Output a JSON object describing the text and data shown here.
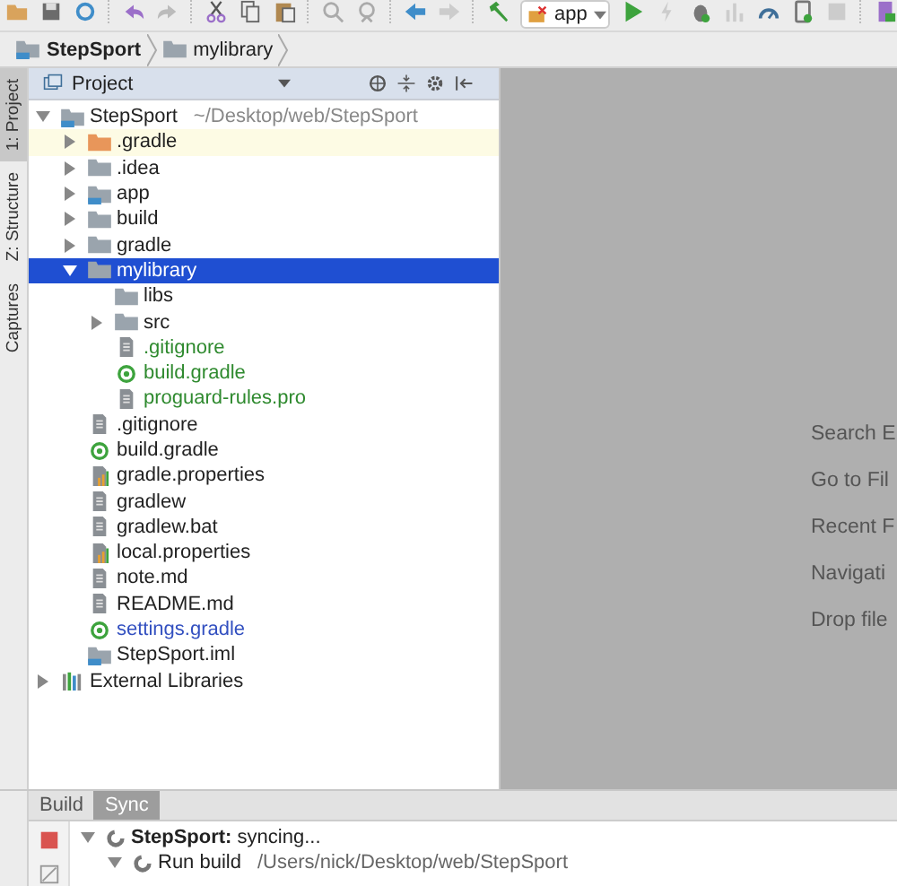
{
  "toolbar": {
    "run_config": "app"
  },
  "breadcrumb": [
    {
      "label": "StepSport",
      "kind": "module"
    },
    {
      "label": "mylibrary",
      "kind": "folder"
    }
  ],
  "side_tabs": [
    {
      "label": "1: Project",
      "selected": true
    },
    {
      "label": "Z: Structure",
      "selected": false
    },
    {
      "label": "Captures",
      "selected": false
    }
  ],
  "project_panel": {
    "title": "Project",
    "tree": [
      {
        "name": "StepSport",
        "path": "~/Desktop/web/StepSport",
        "kind": "module",
        "color": "#222222",
        "expanded": true,
        "selected": false,
        "excluded": false,
        "children": [
          {
            "name": ".gradle",
            "kind": "folder",
            "color": "#222222",
            "expanded": false,
            "selected": false,
            "excluded": true
          },
          {
            "name": ".idea",
            "kind": "folder",
            "color": "#222222",
            "expanded": false,
            "selected": false,
            "excluded": false
          },
          {
            "name": "app",
            "kind": "module",
            "color": "#222222",
            "expanded": false,
            "selected": false,
            "excluded": false
          },
          {
            "name": "build",
            "kind": "folder",
            "color": "#222222",
            "expanded": false,
            "selected": false,
            "excluded": false
          },
          {
            "name": "gradle",
            "kind": "folder",
            "color": "#222222",
            "expanded": false,
            "selected": false,
            "excluded": false
          },
          {
            "name": "mylibrary",
            "kind": "folder",
            "color": "#ffffff",
            "expanded": true,
            "selected": true,
            "excluded": false,
            "children": [
              {
                "name": "libs",
                "kind": "folder",
                "color": "#222222",
                "selected": false,
                "excluded": false
              },
              {
                "name": "src",
                "kind": "folder",
                "color": "#222222",
                "expanded": false,
                "selected": false,
                "excluded": false
              },
              {
                "name": ".gitignore",
                "kind": "file",
                "color": "#2f8a2f",
                "selected": false,
                "excluded": false
              },
              {
                "name": "build.gradle",
                "kind": "gradle",
                "color": "#2f8a2f",
                "selected": false,
                "excluded": false
              },
              {
                "name": "proguard-rules.pro",
                "kind": "file",
                "color": "#2f8a2f",
                "selected": false,
                "excluded": false
              }
            ]
          },
          {
            "name": ".gitignore",
            "kind": "file",
            "color": "#222222",
            "selected": false,
            "excluded": false
          },
          {
            "name": "build.gradle",
            "kind": "gradle",
            "color": "#222222",
            "selected": false,
            "excluded": false
          },
          {
            "name": "gradle.properties",
            "kind": "properties",
            "color": "#222222",
            "selected": false,
            "excluded": false
          },
          {
            "name": "gradlew",
            "kind": "file",
            "color": "#222222",
            "selected": false,
            "excluded": false
          },
          {
            "name": "gradlew.bat",
            "kind": "file",
            "color": "#222222",
            "selected": false,
            "excluded": false
          },
          {
            "name": "local.properties",
            "kind": "properties",
            "color": "#222222",
            "selected": false,
            "excluded": false
          },
          {
            "name": "note.md",
            "kind": "file",
            "color": "#222222",
            "selected": false,
            "excluded": false
          },
          {
            "name": "README.md",
            "kind": "file",
            "color": "#222222",
            "selected": false,
            "excluded": false
          },
          {
            "name": "settings.gradle",
            "kind": "gradle",
            "color": "#3350c0",
            "selected": false,
            "excluded": false
          },
          {
            "name": "StepSport.iml",
            "kind": "iml",
            "color": "#222222",
            "selected": false,
            "excluded": false
          }
        ]
      },
      {
        "name": "External Libraries",
        "kind": "libraries",
        "color": "#222222",
        "expanded": false,
        "selected": false,
        "excluded": false
      }
    ]
  },
  "editor_hints": [
    "Search E",
    "Go to Fil",
    "Recent F",
    "Navigati",
    "Drop file"
  ],
  "bottom_tabs": [
    {
      "label": "Build",
      "selected": false
    },
    {
      "label": "Sync",
      "selected": true
    }
  ],
  "sync_tree": [
    {
      "text": "**StepSport:** syncing..."
    },
    {
      "text": "Run build",
      "path": "/Users/nick/Desktop/web/StepSport"
    }
  ]
}
